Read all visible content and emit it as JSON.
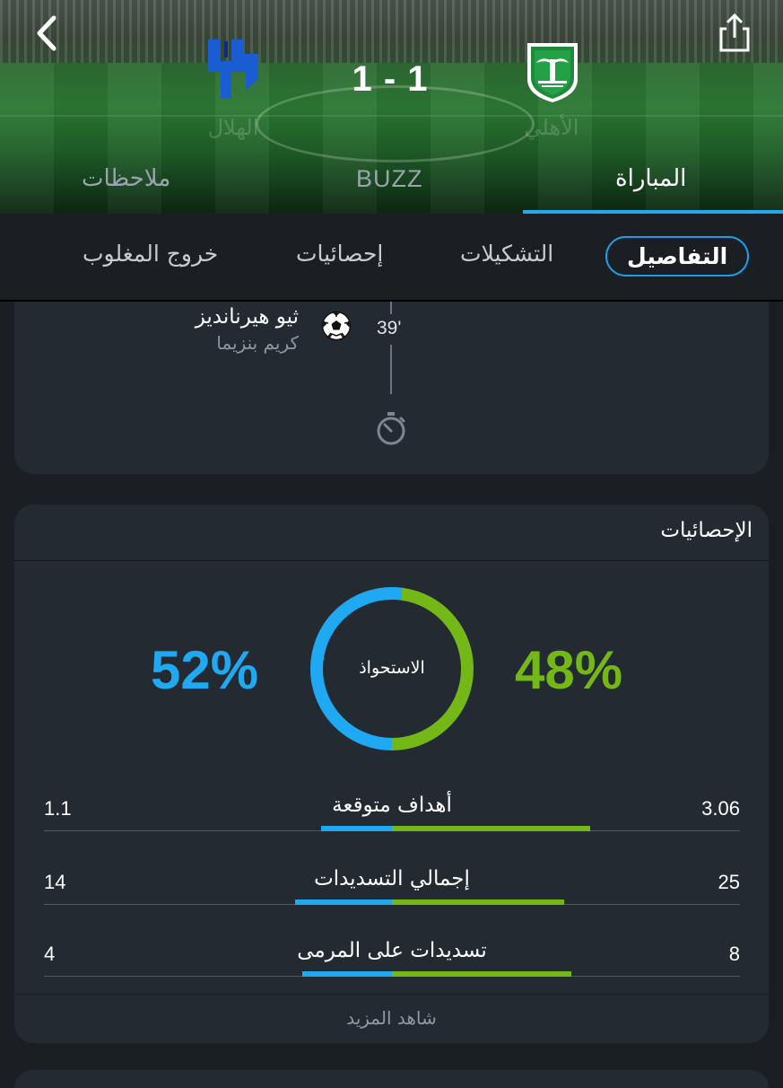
{
  "match": {
    "score": "1 - 1",
    "home_team": "الأهلي",
    "away_team": "الهلال"
  },
  "main_tabs": [
    {
      "label": "المباراة",
      "active": true
    },
    {
      "label": "BUZZ",
      "active": false
    },
    {
      "label": "ملاحظات",
      "active": false
    }
  ],
  "sub_tabs": [
    {
      "label": "التفاصيل",
      "active": true
    },
    {
      "label": "التشكيلات",
      "active": false
    },
    {
      "label": "إحصائيات",
      "active": false
    },
    {
      "label": "خروج المغلوب",
      "active": false
    }
  ],
  "timeline": {
    "minute": "39'",
    "scorer": "ثيو هيرنانديز",
    "assist": "كريم بنزيما"
  },
  "stats": {
    "title": "الإحصائيات",
    "possession": {
      "label": "الاستحواذ",
      "home_pct": "48%",
      "away_pct": "52%",
      "home_value": 48,
      "away_value": 52
    },
    "rows": [
      {
        "label": "أهداف متوقعة",
        "home": "3.06",
        "away": "1.1",
        "home_value": 3.06,
        "away_value": 1.1
      },
      {
        "label": "إجمالي التسديدات",
        "home": "25",
        "away": "14",
        "home_value": 25,
        "away_value": 14
      },
      {
        "label": "تسديدات على المرمى",
        "home": "8",
        "away": "4",
        "home_value": 8,
        "away_value": 4
      }
    ],
    "see_more": "شاهد المزيد"
  },
  "colors": {
    "home": "#73b817",
    "away": "#1ea9f2",
    "accent": "#25a7f0"
  }
}
